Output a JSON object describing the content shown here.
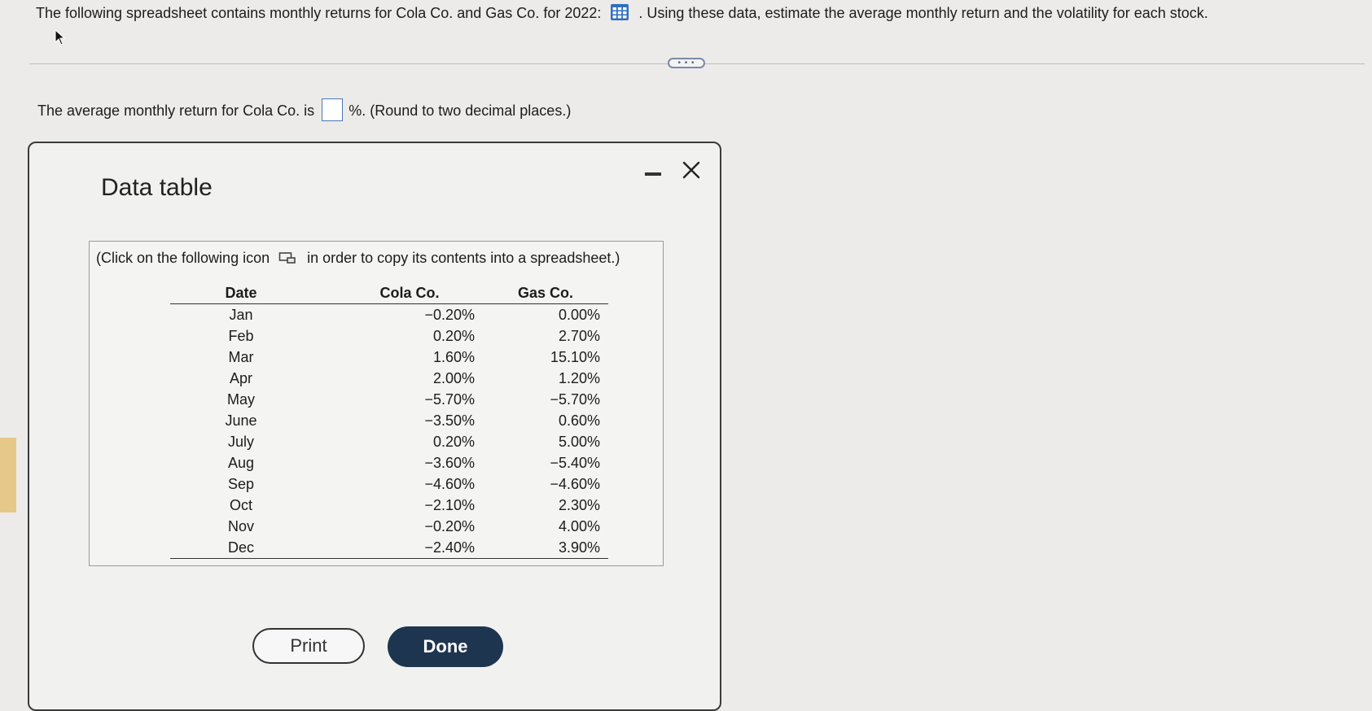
{
  "question": {
    "text_before": "The following spreadsheet contains monthly returns for Cola Co. and Gas Co. for 2022:",
    "text_after": ". Using these data, estimate the average monthly return and the volatility for each stock."
  },
  "prompt": {
    "text_before": "The average monthly return for Cola Co. is",
    "text_after": "%. (Round to two decimal places.)",
    "answer_value": ""
  },
  "more_button_label": "• • •",
  "dialog": {
    "title": "Data table",
    "instruction_before": "(Click on the following icon",
    "instruction_after": "in order to copy its contents into a spreadsheet.)",
    "table": {
      "headers": [
        "Date",
        "Cola Co.",
        "Gas Co."
      ],
      "rows": [
        [
          "Jan",
          "−0.20%",
          "0.00%"
        ],
        [
          "Feb",
          "0.20%",
          "2.70%"
        ],
        [
          "Mar",
          "1.60%",
          "15.10%"
        ],
        [
          "Apr",
          "2.00%",
          "1.20%"
        ],
        [
          "May",
          "−5.70%",
          "−5.70%"
        ],
        [
          "June",
          "−3.50%",
          "0.60%"
        ],
        [
          "July",
          "0.20%",
          "5.00%"
        ],
        [
          "Aug",
          "−3.60%",
          "−5.40%"
        ],
        [
          "Sep",
          "−4.60%",
          "−4.60%"
        ],
        [
          "Oct",
          "−2.10%",
          "2.30%"
        ],
        [
          "Nov",
          "−0.20%",
          "4.00%"
        ],
        [
          "Dec",
          "−2.40%",
          "3.90%"
        ]
      ]
    },
    "print_label": "Print",
    "done_label": "Done"
  },
  "icons": [
    "spreadsheet-grid-icon",
    "cursor-icon",
    "copy-icon",
    "minimize-icon",
    "close-icon"
  ],
  "colors": {
    "background": "#ecebe9",
    "grid_icon": "#2f6fbf",
    "input_border": "#4a78b5",
    "done_button": "#1e3550"
  }
}
